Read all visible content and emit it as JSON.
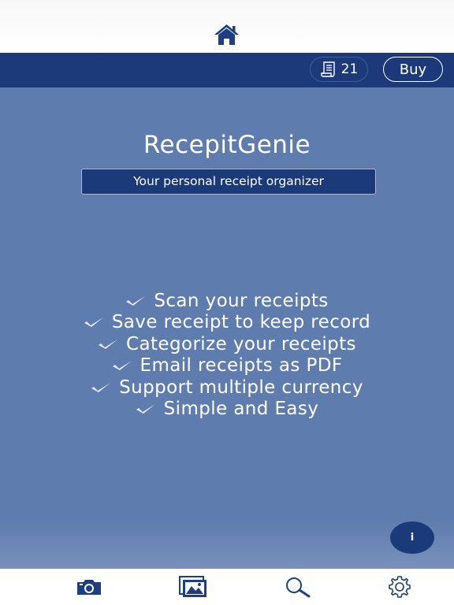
{
  "header": {
    "home_icon": "home-icon"
  },
  "toolbar": {
    "counter_icon": "receipt-icon",
    "counter_value": "21",
    "buy_label": "Buy"
  },
  "main": {
    "app_title": "RecepitGenie",
    "tagline": "Your personal receipt organizer",
    "features": [
      "Scan your receipts",
      "Save receipt to keep record",
      "Categorize your receipts",
      "Email receipts as PDF",
      "Support multiple currency",
      "Simple and Easy"
    ],
    "info_label": "i"
  },
  "tabbar": {
    "tabs": [
      {
        "icon": "camera-icon"
      },
      {
        "icon": "gallery-icon"
      },
      {
        "icon": "search-icon"
      },
      {
        "icon": "gear-icon"
      }
    ]
  },
  "colors": {
    "toolbar_bg": "#1c3a7a",
    "main_bg": "#5f7cae",
    "accent": "#1b3a7a",
    "icon_color": "#1d3f82"
  }
}
